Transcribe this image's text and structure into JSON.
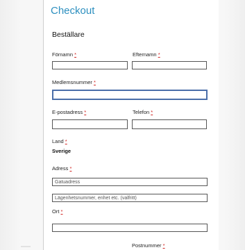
{
  "checkout": {
    "title": "Checkout",
    "section_title": "Beställare",
    "required_marker": "*",
    "fields": {
      "first_name": {
        "label": "Förnamn",
        "value": ""
      },
      "last_name": {
        "label": "Efternamn",
        "value": ""
      },
      "member_number": {
        "label": "Medlemsnummer",
        "value": ""
      },
      "email": {
        "label": "E-postadress",
        "value": ""
      },
      "phone": {
        "label": "Telefon",
        "value": ""
      },
      "country": {
        "label": "Land",
        "value": "Sverige"
      },
      "address": {
        "label": "Adress",
        "placeholder": "Gatuadress"
      },
      "address2": {
        "placeholder": "Lägenhetsnummer, enhet etc. (valfritt)"
      },
      "city": {
        "label": "Ort",
        "value": ""
      },
      "postcode": {
        "label": "Postnummer"
      }
    }
  }
}
